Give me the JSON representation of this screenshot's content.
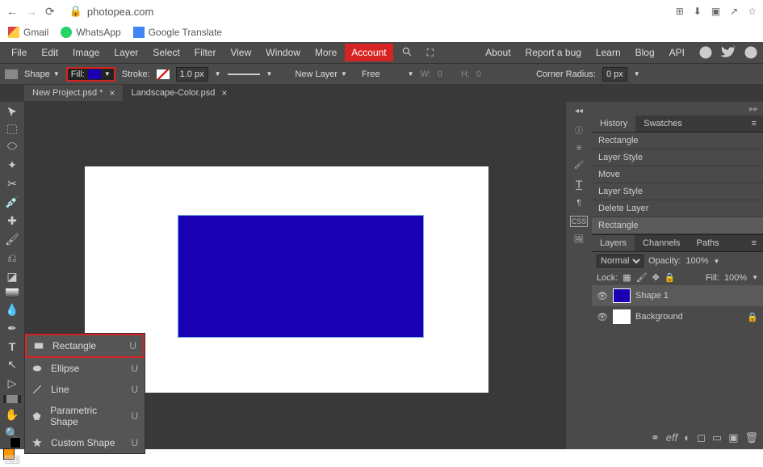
{
  "browser": {
    "url": "photopea.com"
  },
  "bookmarks": [
    {
      "label": "Gmail"
    },
    {
      "label": "WhatsApp"
    },
    {
      "label": "Google Translate"
    }
  ],
  "menu": {
    "items": [
      "File",
      "Edit",
      "Image",
      "Layer",
      "Select",
      "Filter",
      "View",
      "Window",
      "More"
    ],
    "account": "Account",
    "right": [
      "About",
      "Report a bug",
      "Learn",
      "Blog",
      "API"
    ]
  },
  "options": {
    "shape_label": "Shape",
    "fill_label": "Fill:",
    "fill_color": "#1900b3",
    "stroke_label": "Stroke:",
    "stroke_width": "1.0 px",
    "newlayer": "New Layer",
    "free": "Free",
    "w_label": "W:",
    "w_value": "0",
    "h_label": "H:",
    "h_value": "0",
    "corner_label": "Corner Radius:",
    "corner_value": "0 px"
  },
  "tabs": [
    {
      "label": "New Project.psd *",
      "active": true
    },
    {
      "label": "Landscape-Color.psd",
      "active": false
    }
  ],
  "shape_menu": {
    "items": [
      {
        "label": "Rectangle",
        "shortcut": "U",
        "highlight": true
      },
      {
        "label": "Ellipse",
        "shortcut": "U"
      },
      {
        "label": "Line",
        "shortcut": "U"
      },
      {
        "label": "Parametric Shape",
        "shortcut": "U"
      },
      {
        "label": "Custom Shape",
        "shortcut": "U"
      }
    ]
  },
  "panels": {
    "history": {
      "tabs": [
        "History",
        "Swatches"
      ],
      "items": [
        "Rectangle",
        "Layer Style",
        "Move",
        "Layer Style",
        "Delete Layer",
        "Rectangle"
      ]
    },
    "layers": {
      "tabs": [
        "Layers",
        "Channels",
        "Paths"
      ],
      "blend": "Normal",
      "opacity_label": "Opacity:",
      "opacity": "100%",
      "lock_label": "Lock:",
      "fill_label": "Fill:",
      "fill": "100%",
      "items": [
        {
          "name": "Shape 1",
          "thumb": "blue",
          "active": true
        },
        {
          "name": "Background",
          "thumb": "white",
          "locked": true
        }
      ]
    }
  },
  "chart_data": null
}
